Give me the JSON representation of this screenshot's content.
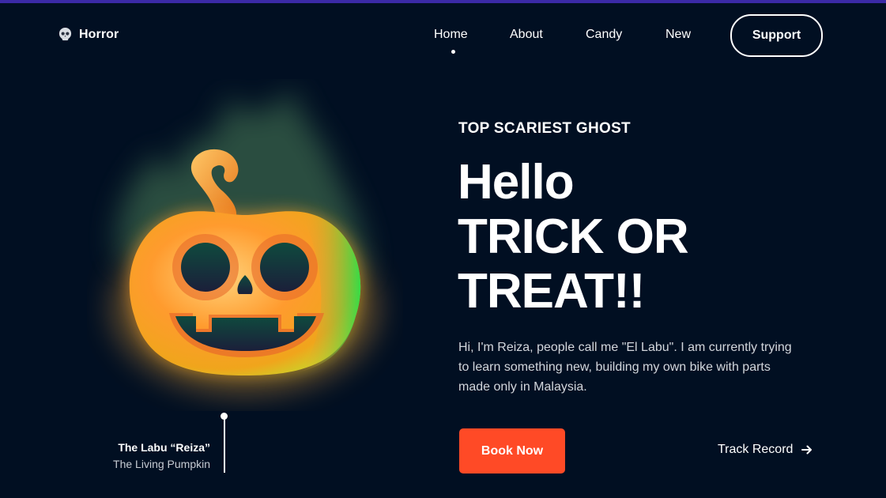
{
  "brand": {
    "name": "Horror",
    "icon": "skull-icon"
  },
  "nav": {
    "items": [
      {
        "label": "Home",
        "active": true
      },
      {
        "label": "About"
      },
      {
        "label": "Candy"
      },
      {
        "label": "New"
      }
    ],
    "support_label": "Support"
  },
  "hero": {
    "eyebrow": "TOP SCARIEST GHOST",
    "headline": [
      "Hello",
      "TRICK OR",
      "TREAT!!"
    ],
    "description": "Hi, I'm Reiza, people call me \"El Labu\". I am currently trying to learn something new, building my own bike with parts made only in Malaysia.",
    "book_label": "Book Now",
    "track_label": "Track Record",
    "track_icon": "arrow-right-icon"
  },
  "caption": {
    "name": "The Labu “Reiza”",
    "subtitle": "The Living Pumpkin"
  },
  "colors": {
    "background": "#010f22",
    "accent": "#ff4a26",
    "pumpkin": "#f7931e",
    "glow": "#6fae6a"
  }
}
